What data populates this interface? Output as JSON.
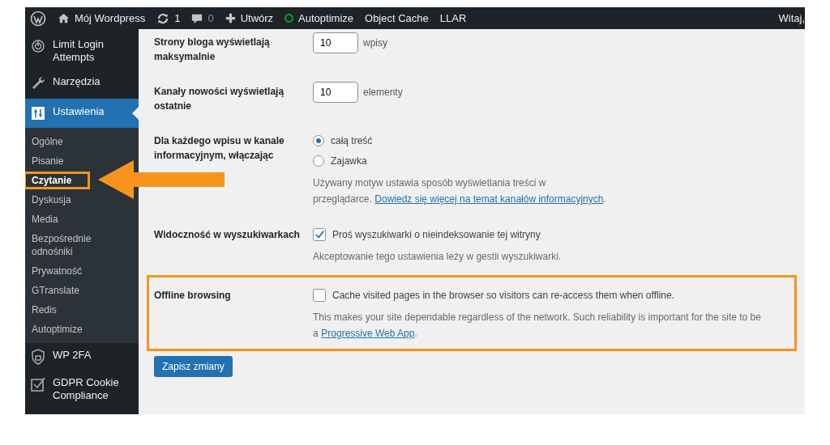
{
  "admin_bar": {
    "site": "Mój Wordpress",
    "updates": "1",
    "comments": "0",
    "new": "Utwórz",
    "items": [
      {
        "label": "Autoptimize",
        "kind": "status",
        "color": "#00a32a"
      },
      {
        "label": "Object Cache",
        "kind": "plain"
      },
      {
        "label": "LLAR",
        "kind": "plain"
      }
    ],
    "greeting": "Witaj,"
  },
  "sidebar": {
    "items": [
      {
        "label": "Limit Login Attempts",
        "selected": false
      },
      {
        "label": "Narzędzia",
        "selected": false
      },
      {
        "label": "Ustawienia",
        "selected": true,
        "children": [
          {
            "label": "Ogólne",
            "selected": false,
            "highlighted": false
          },
          {
            "label": "Pisanie",
            "selected": false,
            "highlighted": false
          },
          {
            "label": "Czytanie",
            "selected": true,
            "highlighted": true
          },
          {
            "label": "Dyskusja",
            "selected": false,
            "highlighted": false
          },
          {
            "label": "Media",
            "selected": false,
            "highlighted": false
          },
          {
            "label": "Bezpośrednie odnośniki",
            "selected": false,
            "highlighted": false
          },
          {
            "label": "Prywatność",
            "selected": false,
            "highlighted": false
          },
          {
            "label": "GTranslate",
            "selected": false,
            "highlighted": false
          },
          {
            "label": "Redis",
            "selected": false,
            "highlighted": false
          },
          {
            "label": "Autoptimize",
            "selected": false,
            "highlighted": false
          }
        ]
      },
      {
        "label": "WP 2FA",
        "selected": false
      },
      {
        "label": "GDPR Cookie Compliance",
        "selected": false
      }
    ]
  },
  "form": {
    "rows": [
      {
        "kind": "number",
        "label": "Strony bloga wyświetlają maksymalnie",
        "value": "10",
        "unit": "wpisy",
        "highlighted": false
      },
      {
        "kind": "number",
        "label": "Kanały nowości wyświetlają ostatnie",
        "value": "10",
        "unit": "elementy",
        "highlighted": false
      },
      {
        "kind": "radio",
        "label": "Dla każdego wpisu w kanale informacyjnym, włączając",
        "options": [
          {
            "label": "całą treść",
            "selected": true
          },
          {
            "label": "Zajawka",
            "selected": false
          }
        ],
        "description": "Używany motyw ustawia sposób wyświetlania treści w przeglądarce.",
        "link": "Dowiedz się więcej na temat kanałów informacyjnych",
        "after": ".",
        "highlighted": false
      },
      {
        "kind": "checkbox",
        "label": "Widoczność w wyszukiwarkach",
        "option": {
          "label": "Proś wyszukiwarki o nieindeksowanie tej witryny",
          "checked": true
        },
        "description": "Akceptowanie tego ustawienia leży w gestii wyszukiwarki.",
        "highlighted": false
      },
      {
        "kind": "checkbox",
        "label": "Offline browsing",
        "option": {
          "label": "Cache visited pages in the browser so visitors can re-access them when offline.",
          "checked": false
        },
        "description": "This makes your site dependable regardless of the network. Such reliability is important for the site to be a",
        "link": "Progressive Web App",
        "after": ".",
        "highlighted": true
      }
    ],
    "submit": "Zapisz zmiany"
  }
}
